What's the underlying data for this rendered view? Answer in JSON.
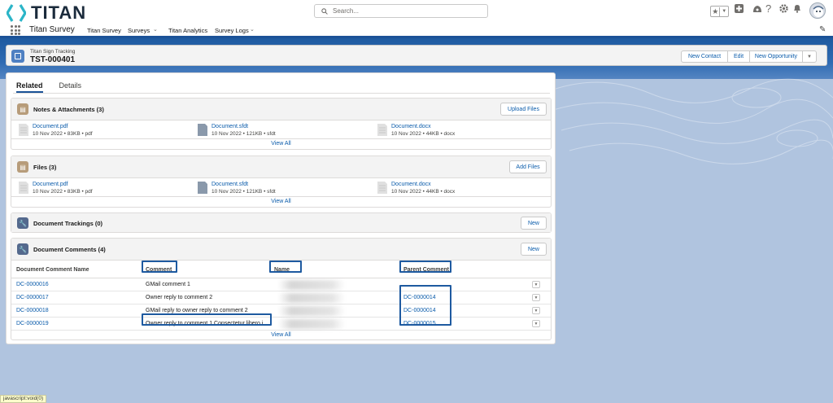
{
  "brand": {
    "name": "TITAN",
    "accent": "#1b5297",
    "logo_color": "#2cb5c8"
  },
  "header": {
    "search_placeholder": "Search...",
    "icons": [
      "favorites-star-icon",
      "add-icon",
      "trailhead-icon",
      "help-icon",
      "gear-icon",
      "bell-icon",
      "avatar"
    ]
  },
  "nav": {
    "app_name": "Titan Survey",
    "items": [
      {
        "label": "Titan Survey"
      },
      {
        "label": "Surveys"
      },
      {
        "label": "Titan Analytics"
      },
      {
        "label": "Survey Logs"
      }
    ]
  },
  "record": {
    "type": "Titan Sign Tracking",
    "title": "TST-000401",
    "actions": [
      "New Contact",
      "Edit",
      "New Opportunity"
    ]
  },
  "tabs": [
    "Related",
    "Details"
  ],
  "notes": {
    "title": "Notes & Attachments (3)",
    "button": "Upload Files",
    "files": [
      {
        "name": "Document.pdf",
        "meta": "10 Nov 2022 • 83KB • pdf"
      },
      {
        "name": "Document.sfdt",
        "meta": "10 Nov 2022 • 121KB • sfdt"
      },
      {
        "name": "Document.docx",
        "meta": "10 Nov 2022 • 44KB • docx"
      }
    ],
    "view_all": "View All"
  },
  "files": {
    "title": "Files (3)",
    "button": "Add Files",
    "files": [
      {
        "name": "Document.pdf",
        "meta": "10 Nov 2022 • 83KB • pdf"
      },
      {
        "name": "Document.sfdt",
        "meta": "10 Nov 2022 • 121KB • sfdt"
      },
      {
        "name": "Document.docx",
        "meta": "10 Nov 2022 • 44KB • docx"
      }
    ],
    "view_all": "View All"
  },
  "trackings": {
    "title": "Document Trackings (0)",
    "button": "New"
  },
  "comments": {
    "title": "Document Comments (4)",
    "button": "New",
    "columns": [
      "Document Comment Name",
      "Comment",
      "Name",
      "Parent Comment"
    ],
    "rows": [
      {
        "id": "DC-0000016",
        "comment": "GMail comment 1",
        "parent": ""
      },
      {
        "id": "DC-0000017",
        "comment": "Owner reply to comment 2",
        "parent": "DC-0000014"
      },
      {
        "id": "DC-0000018",
        "comment": "GMail reply to owner reply to comment 2",
        "parent": "DC-0000014"
      },
      {
        "id": "DC-0000019",
        "comment": "Owner reply to comment 1 Consectetur libero i...",
        "parent": "DC-0000015"
      }
    ],
    "view_all": "View All"
  },
  "status_bar": "javascript:void(0)"
}
